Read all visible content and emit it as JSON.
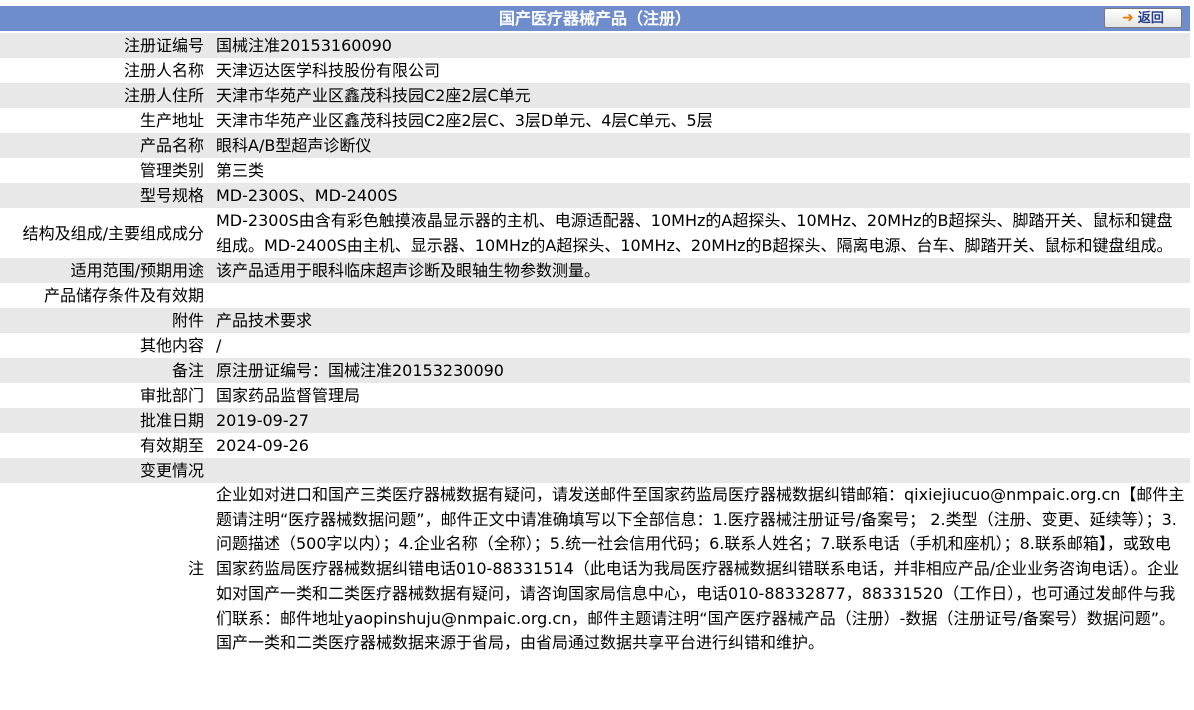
{
  "header": {
    "title": "国产医疗器械产品（注册）",
    "back_label": "返回"
  },
  "rows": [
    {
      "label": "注册证编号",
      "value": "国械注准20153160090"
    },
    {
      "label": "注册人名称",
      "value": "天津迈达医学科技股份有限公司"
    },
    {
      "label": "注册人住所",
      "value": "天津市华苑产业区鑫茂科技园C2座2层C单元"
    },
    {
      "label": "生产地址",
      "value": "天津市华苑产业区鑫茂科技园C2座2层C、3层D单元、4层C单元、5层"
    },
    {
      "label": "产品名称",
      "value": "眼科A/B型超声诊断仪"
    },
    {
      "label": "管理类别",
      "value": "第三类"
    },
    {
      "label": "型号规格",
      "value": "MD-2300S、MD-2400S"
    },
    {
      "label": "结构及组成/主要组成成分",
      "value": "MD-2300S由含有彩色触摸液晶显示器的主机、电源适配器、10MHz的A超探头、10MHz、20MHz的B超探头、脚踏开关、鼠标和键盘组成。MD-2400S由主机、显示器、10MHz的A超探头、10MHz、20MHz的B超探头、隔离电源、台车、脚踏开关、鼠标和键盘组成。"
    },
    {
      "label": "适用范围/预期用途",
      "value": "该产品适用于眼科临床超声诊断及眼轴生物参数测量。"
    },
    {
      "label": "产品储存条件及有效期",
      "value": ""
    },
    {
      "label": "附件",
      "value": "产品技术要求"
    },
    {
      "label": "其他内容",
      "value": "/"
    },
    {
      "label": "备注",
      "value": "原注册证编号：国械注准20153230090"
    },
    {
      "label": "审批部门",
      "value": "国家药品监督管理局"
    },
    {
      "label": "批准日期",
      "value": "2019-09-27"
    },
    {
      "label": "有效期至",
      "value": "2024-09-26"
    },
    {
      "label": "变更情况",
      "value": ""
    }
  ],
  "note": {
    "label": "注",
    "value": "企业如对进口和国产三类医疗器械数据有疑问，请发送邮件至国家药监局医疗器械数据纠错邮箱：qixiejiucuo@nmpaic.org.cn【邮件主题请注明“医疗器械数据问题”，邮件正文中请准确填写以下全部信息：1.医疗器械注册证号/备案号； 2.类型（注册、变更、延续等）；3.问题描述（500字以内）；4.企业名称（全称）；5.统一社会信用代码；6.联系人姓名；7.联系电话（手机和座机）；8.联系邮箱】，或致电国家药监局医疗器械数据纠错电话010-88331514（此电话为我局医疗器械数据纠错联系电话，并非相应产品/企业业务咨询电话）。企业如对国产一类和二类医疗器械数据有疑问，请咨询国家局信息中心，电话010-88332877，88331520（工作日），也可通过发邮件与我们联系：邮件地址yaopinshuju@nmpaic.org.cn，邮件主题请注明“国产医疗器械产品（注册）-数据（注册证号/备案号）数据问题”。国产一类和二类医疗器械数据来源于省局，由省局通过数据共享平台进行纠错和维护。"
  },
  "colors": {
    "title_bar": "#6f8ccd",
    "row_alt": "#e8e8e8",
    "row_plain": "#ffffff"
  }
}
